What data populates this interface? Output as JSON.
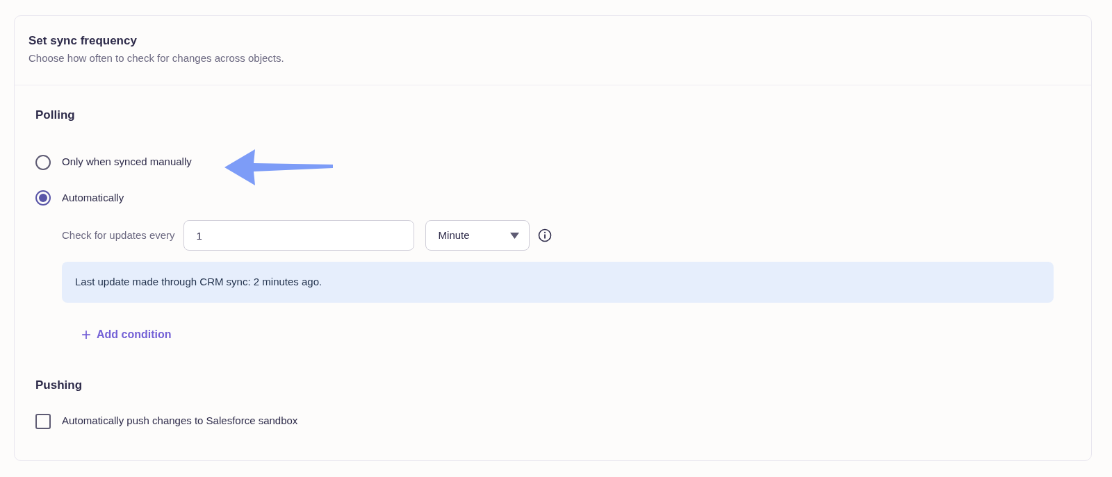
{
  "section": {
    "title": "Set sync frequency",
    "subtitle": "Choose how often to check for changes across objects."
  },
  "polling": {
    "heading": "Polling",
    "options": [
      {
        "label": "Only when synced manually",
        "selected": false,
        "annotated": true
      },
      {
        "label": "Automatically",
        "selected": true,
        "annotated": false
      }
    ],
    "interval": {
      "label": "Check for updates every",
      "value": "1",
      "unit": "Minute"
    },
    "notice": "Last update made through CRM sync: 2 minutes ago.",
    "add_button": {
      "icon": "+",
      "label": "Add condition"
    }
  },
  "pushing": {
    "heading": "Pushing",
    "options": [
      {
        "label": "Automatically push changes to Salesforce sandbox",
        "checked": false
      }
    ]
  }
}
